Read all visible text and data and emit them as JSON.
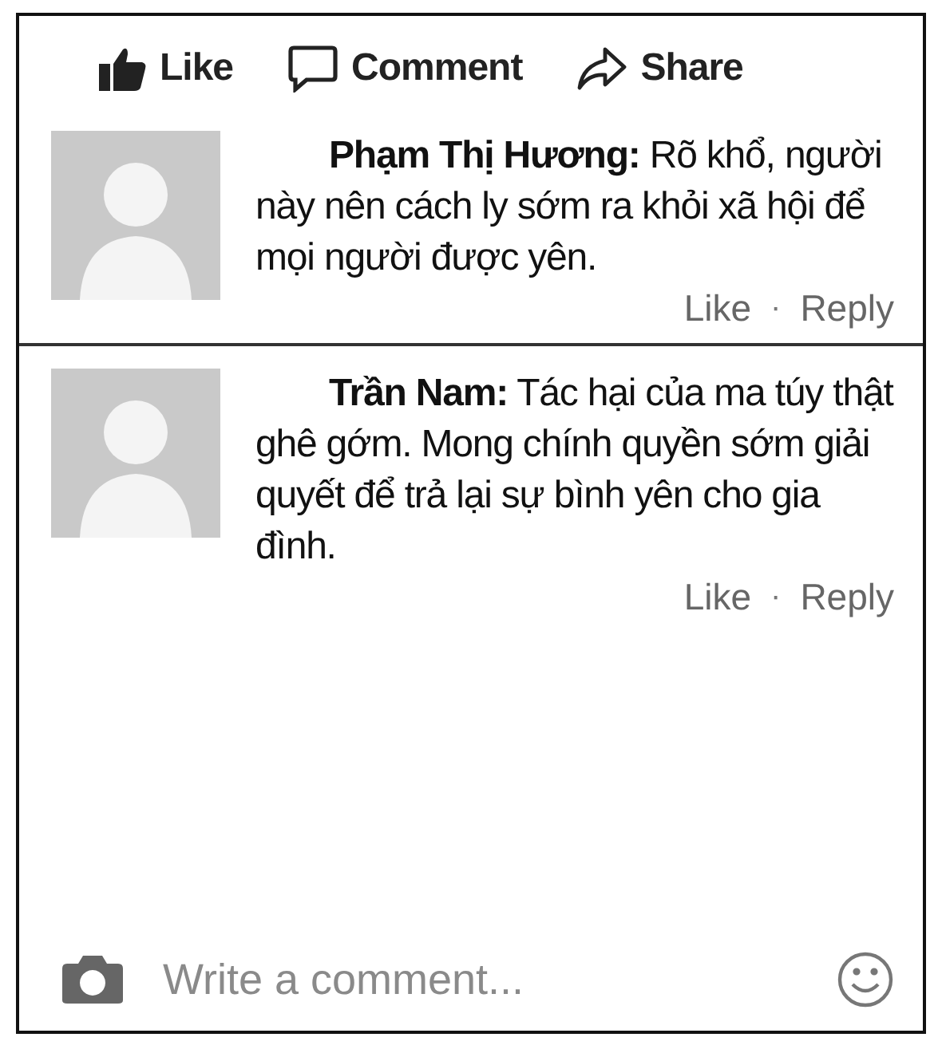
{
  "actions": [
    {
      "kind": "like",
      "label": "Like"
    },
    {
      "kind": "comment",
      "label": "Comment"
    },
    {
      "kind": "share",
      "label": "Share"
    }
  ],
  "comments": [
    {
      "author": "Phạm Thị Hương:",
      "text": "Rõ khổ, người này nên cách ly sớm ra khỏi xã hội để mọi người được yên.",
      "like": "Like",
      "separator": "·",
      "reply": "Reply"
    },
    {
      "author": "Trần Nam:",
      "text": "Tác hại của ma túy thật ghê gớm. Mong chính quyền sớm giải quyết để trả lại sự bình yên cho gia đình.",
      "like": "Like",
      "separator": "·",
      "reply": "Reply"
    }
  ],
  "composer": {
    "placeholder": "Write a comment..."
  }
}
